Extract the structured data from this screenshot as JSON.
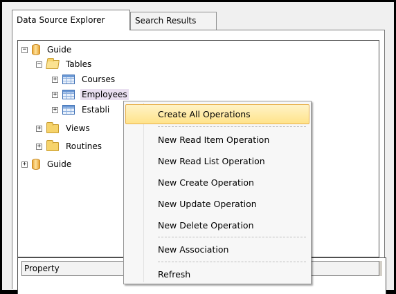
{
  "tabs": [
    {
      "label": "Data Source Explorer",
      "active": true
    },
    {
      "label": "Search Results",
      "active": false
    }
  ],
  "tree": {
    "nodes": [
      {
        "label": "Guide",
        "icon": "database-icon",
        "expander": "−"
      },
      {
        "label": "Tables",
        "icon": "folder-open-icon",
        "expander": "−"
      },
      {
        "label": "Courses",
        "icon": "table-icon",
        "expander": "+"
      },
      {
        "label": "Employees",
        "icon": "table-icon",
        "expander": "+"
      },
      {
        "label": "Establi",
        "icon": "table-icon",
        "expander": "+"
      },
      {
        "label": "Views",
        "icon": "folder-icon",
        "expander": "+"
      },
      {
        "label": "Routines",
        "icon": "folder-icon",
        "expander": "+"
      },
      {
        "label": "Guide",
        "icon": "database-icon",
        "expander": "+"
      }
    ]
  },
  "property_grid": {
    "header": "Property"
  },
  "context_menu": {
    "items": [
      {
        "label": "Create All Operations",
        "selected": true
      },
      {
        "label": "New Read Item Operation"
      },
      {
        "label": "New Read List Operation"
      },
      {
        "label": "New Create Operation"
      },
      {
        "label": "New Update Operation"
      },
      {
        "label": "New Delete Operation"
      },
      {
        "label": "New Association"
      },
      {
        "label": "Refresh"
      }
    ]
  },
  "colors": {
    "selection": "#ffe38a",
    "hover_row": "#e9dff0",
    "table_icon": "#3d6fb4",
    "folder_icon": "#f6d36b"
  }
}
